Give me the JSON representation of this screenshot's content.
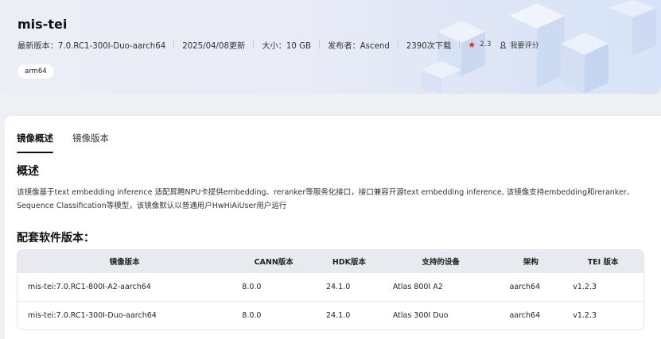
{
  "header": {
    "title": "mis-tei",
    "meta": {
      "latest_version": "最新版本：7.0.RC1-300I-Duo-aarch64",
      "updated": "2025/04/08更新",
      "size": "大小：10 GB",
      "publisher": "发布者：Ascend",
      "downloads": "2390次下载",
      "rating": "2.3",
      "rate_label": "我要评分"
    },
    "tag": "arm64"
  },
  "tabs": [
    {
      "label": "镜像概述",
      "active": true
    },
    {
      "label": "镜像版本",
      "active": false
    }
  ],
  "overview": {
    "heading": "概述",
    "text": "该镜像基于text embedding inference 适配昇腾NPU卡提供embedding、reranker等服务化接口，接口兼容开源text embedding inference, 该镜像支持embedding和reranker、Sequence Classification等模型，该镜像默认以普通用户HwHiAiUser用户运行"
  },
  "software": {
    "heading": "配套软件版本：",
    "columns": [
      "镜像版本",
      "CANN版本",
      "HDK版本",
      "支持的设备",
      "架构",
      "TEI 版本"
    ],
    "rows": [
      [
        "mis-tei:7.0.RC1-800I-A2-aarch64",
        "8.0.0",
        "24.1.0",
        "Atlas 800I A2",
        "aarch64",
        "v1.2.3"
      ],
      [
        "mis-tei:7.0.RC1-300I-Duo-aarch64",
        "8.0.0",
        "24.1.0",
        "Atlas 300I Duo",
        "aarch64",
        "v1.2.3"
      ]
    ]
  },
  "colors": {
    "star": "#d9262e",
    "header_bg": "#e9ecf7"
  }
}
